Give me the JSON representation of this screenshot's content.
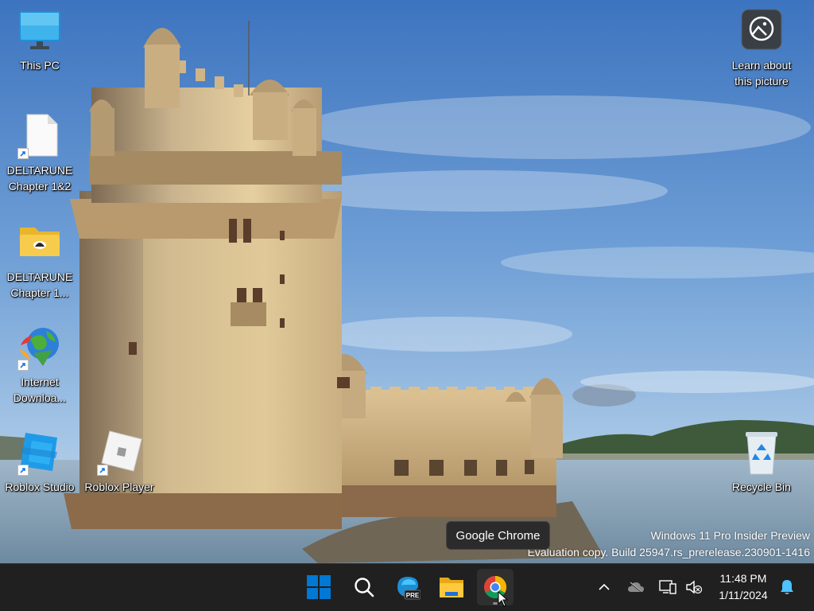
{
  "desktop": {
    "icons": [
      {
        "label": "This PC"
      },
      {
        "label": "DELTARUNE\nChapter 1&2"
      },
      {
        "label": "DELTARUNE\nChapter 1..."
      },
      {
        "label": "Internet\nDownloa..."
      },
      {
        "label": "Roblox Studio"
      },
      {
        "label": "Roblox Player"
      },
      {
        "label": "Learn about\nthis picture"
      },
      {
        "label": "Recycle Bin"
      }
    ]
  },
  "tooltip": {
    "text": "Google Chrome"
  },
  "watermark": {
    "line1": "Windows 11 Pro Insider Preview",
    "line2": "Evaluation copy. Build 25947.rs_prerelease.230901-1416"
  },
  "taskbar": {
    "apps": [
      "start-icon",
      "search-icon",
      "edge-preview-icon",
      "file-explorer-icon",
      "chrome-icon"
    ],
    "active_app": "Google Chrome",
    "edge_badge": "PRE",
    "clock": {
      "time": "11:48 PM",
      "date": "1/11/2024"
    }
  },
  "colors": {
    "taskbar_bg": "#202020",
    "sky": "#5b8fc9",
    "windows_blue": "#0078d4"
  }
}
